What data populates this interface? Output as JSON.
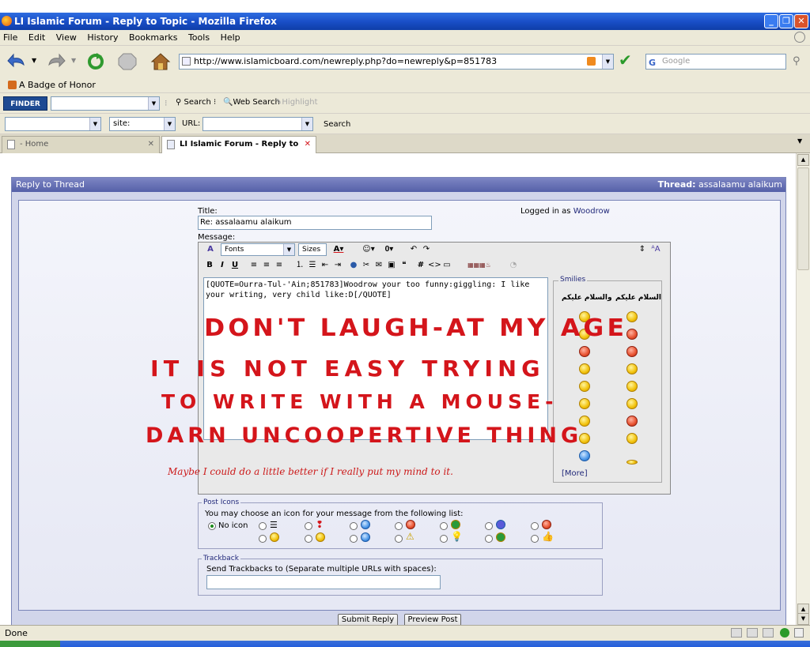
{
  "window": {
    "title": "LI Islamic Forum - Reply to Topic - Mozilla Firefox"
  },
  "menu": [
    "File",
    "Edit",
    "View",
    "History",
    "Bookmarks",
    "Tools",
    "Help"
  ],
  "nav": {
    "url": "http://www.islamicboard.com/newreply.php?do=newreply&p=851783",
    "search_placeholder": "Google"
  },
  "bookmarks": {
    "item": "A Badge of Honor"
  },
  "finderbar": {
    "logo": "FINDER",
    "search": "Search",
    "web_search": "Web Search",
    "highlight": "Highlight"
  },
  "sitebar": {
    "site": "site:",
    "url_label": "URL:",
    "search": "Search"
  },
  "tabs": [
    {
      "label": "- Home"
    },
    {
      "label": "LI Islamic Forum - Reply to Topic"
    }
  ],
  "panel": {
    "heading": "Reply to Thread",
    "thread_label": "Thread:",
    "thread_title": "assalaamu alaikum"
  },
  "form": {
    "title_label": "Title:",
    "title_value": "Re: assalaamu alaikum",
    "logged_in_label": "Logged in as",
    "logged_in_user": "Woodrow",
    "message_label": "Message:",
    "fonts": "Fonts",
    "sizes": "Sizes",
    "message": "[QUOTE=Ourra-Tul-'Ain;851783]Woodrow your too funny:giggling: I like your writing, very child like:D[/QUOTE]",
    "smilies_legend": "Smilies",
    "smilies_col1": "والسلام عليكم",
    "smilies_col2": "السلام عليكم",
    "more": "[More]"
  },
  "handwriting": {
    "line1": "DON'T LAUGH-AT MY AGE",
    "line2": "IT IS NOT EASY TRYING",
    "line3": "TO WRITE WITH A MOUSE-",
    "line4": "DARN UNCOOPERTIVE THING",
    "note": "Maybe I could do a little better if I really put my mind to it."
  },
  "post_icons": {
    "legend": "Post Icons",
    "instructions": "You may choose an icon for your message from the following list:",
    "no_icon": "No icon"
  },
  "trackback": {
    "legend": "Trackback",
    "label": "Send Trackbacks to (Separate multiple URLs with spaces):"
  },
  "buttons": {
    "submit": "Submit Reply",
    "preview": "Preview Post"
  },
  "status": {
    "text": "Done"
  }
}
